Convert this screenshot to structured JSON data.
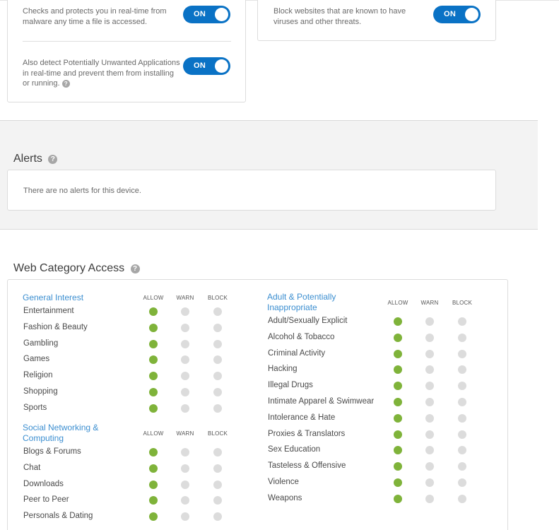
{
  "protection": {
    "file_scan": {
      "description": "Checks and protects you in real-time from malware any time a file is accessed.",
      "toggle": "ON"
    },
    "pua": {
      "description": "Also detect Potentially Unwanted Applications in real-time and prevent them from installing or running.",
      "toggle": "ON"
    },
    "web_block": {
      "description": "Block websites that are known to have viruses and other threats.",
      "toggle": "ON"
    }
  },
  "alerts": {
    "title": "Alerts",
    "message": "There are no alerts for this device."
  },
  "web_access": {
    "title": "Web Category Access",
    "columns": [
      "ALLOW",
      "WARN",
      "BLOCK"
    ],
    "groups": [
      {
        "name": "General Interest",
        "name_lines": [
          "General Interest"
        ],
        "categories": [
          {
            "name": "Entertainment",
            "setting": "ALLOW"
          },
          {
            "name": "Fashion & Beauty",
            "setting": "ALLOW"
          },
          {
            "name": "Gambling",
            "setting": "ALLOW"
          },
          {
            "name": "Games",
            "setting": "ALLOW"
          },
          {
            "name": "Religion",
            "setting": "ALLOW"
          },
          {
            "name": "Shopping",
            "setting": "ALLOW"
          },
          {
            "name": "Sports",
            "setting": "ALLOW"
          }
        ]
      },
      {
        "name": "Social Networking & Computing",
        "name_lines": [
          "Social Networking &",
          "Computing"
        ],
        "categories": [
          {
            "name": "Blogs & Forums",
            "setting": "ALLOW"
          },
          {
            "name": "Chat",
            "setting": "ALLOW"
          },
          {
            "name": "Downloads",
            "setting": "ALLOW"
          },
          {
            "name": "Peer to Peer",
            "setting": "ALLOW"
          },
          {
            "name": "Personals & Dating",
            "setting": "ALLOW"
          }
        ]
      },
      {
        "name": "Adult & Potentially Inappropriate",
        "name_lines": [
          "Adult & Potentially",
          "Inappropriate"
        ],
        "categories": [
          {
            "name": "Adult/Sexually Explicit",
            "setting": "ALLOW"
          },
          {
            "name": "Alcohol & Tobacco",
            "setting": "ALLOW"
          },
          {
            "name": "Criminal Activity",
            "setting": "ALLOW"
          },
          {
            "name": "Hacking",
            "setting": "ALLOW"
          },
          {
            "name": "Illegal Drugs",
            "setting": "ALLOW"
          },
          {
            "name": "Intimate Apparel & Swimwear",
            "setting": "ALLOW"
          },
          {
            "name": "Intolerance & Hate",
            "setting": "ALLOW"
          },
          {
            "name": "Proxies & Translators",
            "setting": "ALLOW"
          },
          {
            "name": "Sex Education",
            "setting": "ALLOW"
          },
          {
            "name": "Tasteless & Offensive",
            "setting": "ALLOW"
          },
          {
            "name": "Violence",
            "setting": "ALLOW"
          },
          {
            "name": "Weapons",
            "setting": "ALLOW"
          }
        ]
      }
    ]
  },
  "colors": {
    "toggle_on": "#0a72c5",
    "allow_dot": "#7fb33a",
    "inactive_dot": "#dcdcdc",
    "group_heading": "#3b8ed0"
  },
  "icons": {
    "help": "question-mark-circle-icon"
  }
}
